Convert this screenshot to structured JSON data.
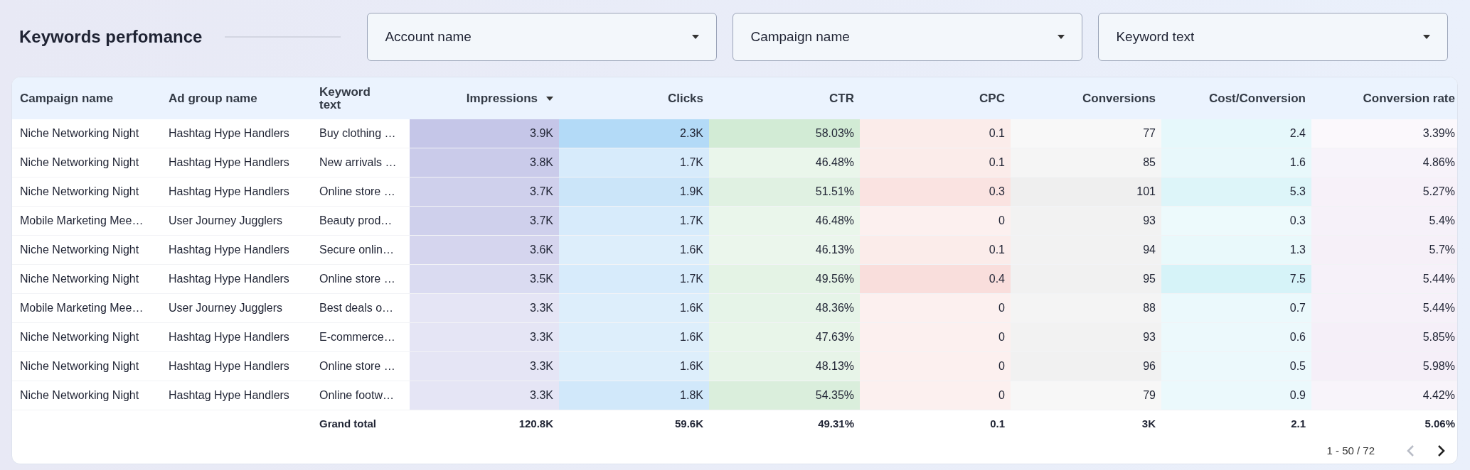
{
  "header": {
    "title": "Keywords perfomance"
  },
  "filters": [
    {
      "label": "Account name"
    },
    {
      "label": "Campaign name"
    },
    {
      "label": "Keyword text"
    }
  ],
  "table": {
    "columns": [
      {
        "label": "Campaign name",
        "sorted": false
      },
      {
        "label": "Ad group name",
        "sorted": false
      },
      {
        "label": "Keyword text",
        "sorted": false
      },
      {
        "label": "Impressions",
        "sorted": true,
        "color": "#c5c6e8"
      },
      {
        "label": "Clicks",
        "sorted": false,
        "color": "#b3daf7"
      },
      {
        "label": "CTR",
        "sorted": false,
        "color": "#d2ebd5"
      },
      {
        "label": "CPC",
        "sorted": false,
        "color": "#f9dedc"
      },
      {
        "label": "Conversions",
        "sorted": false,
        "color": "#efefef"
      },
      {
        "label": "Cost/Conversion",
        "sorted": false,
        "color": "#d6f3f8"
      },
      {
        "label": "Conversion rate",
        "sorted": false,
        "color": "#f5eff8"
      }
    ],
    "rows": [
      [
        "Niche Networking Night",
        "Hashtag Hype Handlers",
        "Buy clothing …",
        "3.9K",
        "2.3K",
        "58.03%",
        "0.1",
        "77",
        "2.4",
        "3.39%"
      ],
      [
        "Niche Networking Night",
        "Hashtag Hype Handlers",
        "New arrivals …",
        "3.8K",
        "1.7K",
        "46.48%",
        "0.1",
        "85",
        "1.6",
        "4.86%"
      ],
      [
        "Niche Networking Night",
        "Hashtag Hype Handlers",
        "Online store …",
        "3.7K",
        "1.9K",
        "51.51%",
        "0.3",
        "101",
        "5.3",
        "5.27%"
      ],
      [
        "Mobile Marketing Mee…",
        "User Journey Jugglers",
        "Beauty prod…",
        "3.7K",
        "1.7K",
        "46.48%",
        "0",
        "93",
        "0.3",
        "5.4%"
      ],
      [
        "Niche Networking Night",
        "Hashtag Hype Handlers",
        "Secure onlin…",
        "3.6K",
        "1.6K",
        "46.13%",
        "0.1",
        "94",
        "1.3",
        "5.7%"
      ],
      [
        "Niche Networking Night",
        "Hashtag Hype Handlers",
        "Online store …",
        "3.5K",
        "1.7K",
        "49.56%",
        "0.4",
        "95",
        "7.5",
        "5.44%"
      ],
      [
        "Mobile Marketing Mee…",
        "User Journey Jugglers",
        "Best deals o…",
        "3.3K",
        "1.6K",
        "48.36%",
        "0",
        "88",
        "0.7",
        "5.44%"
      ],
      [
        "Niche Networking Night",
        "Hashtag Hype Handlers",
        "E-commerce…",
        "3.3K",
        "1.6K",
        "47.63%",
        "0",
        "93",
        "0.6",
        "5.85%"
      ],
      [
        "Niche Networking Night",
        "Hashtag Hype Handlers",
        "Online store …",
        "3.3K",
        "1.6K",
        "48.13%",
        "0",
        "96",
        "0.5",
        "5.98%"
      ],
      [
        "Niche Networking Night",
        "Hashtag Hype Handlers",
        "Online footw…",
        "3.3K",
        "1.8K",
        "54.35%",
        "0",
        "79",
        "0.9",
        "4.42%"
      ]
    ],
    "total": {
      "label": "Grand total",
      "values": [
        "120.8K",
        "59.6K",
        "49.31%",
        "0.1",
        "3K",
        "2.1",
        "5.06%"
      ]
    }
  },
  "pagination": {
    "range": "1 - 50 / 72",
    "prev_disabled": true,
    "next_disabled": false
  }
}
